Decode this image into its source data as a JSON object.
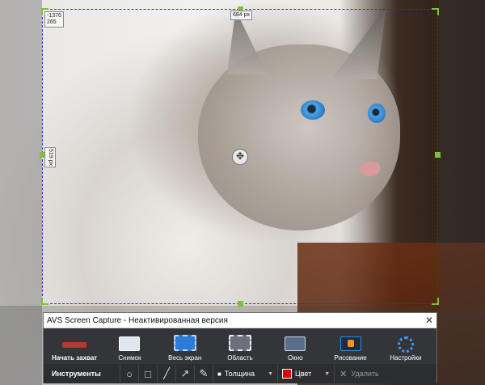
{
  "selection": {
    "offset_readout": {
      "x": "-1376",
      "y": "265"
    },
    "width_readout": "684 px",
    "height_readout": "519 px",
    "move_icon": "move-cross-icon"
  },
  "window": {
    "title": "AVS Screen Capture - Неактивированная версия",
    "close_label": "✕",
    "toolbar": [
      {
        "label": "Начать захват",
        "icon": "record-icon"
      },
      {
        "label": "Снимок",
        "icon": "camera-icon"
      },
      {
        "label": "Весь экран",
        "icon": "fullscreen-icon"
      },
      {
        "label": "Область",
        "icon": "area-icon"
      },
      {
        "label": "Окно",
        "icon": "window-icon"
      },
      {
        "label": "Рисование",
        "icon": "draw-icon"
      },
      {
        "label": "Настройки",
        "icon": "gear-icon"
      }
    ],
    "tools": {
      "label": "Инструменты",
      "shapes": [
        "ellipse-icon",
        "rectangle-icon",
        "line-icon",
        "arrow-icon",
        "pen-icon"
      ],
      "thickness_label": "Толщина",
      "color_label": "Цвет",
      "color_value": "#e00000",
      "delete_label": "Удалить"
    }
  }
}
